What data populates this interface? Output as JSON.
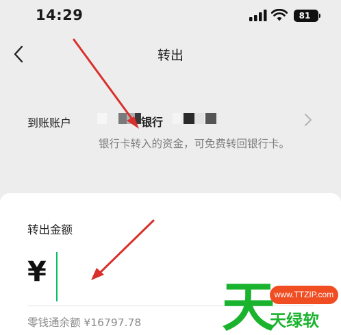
{
  "status_bar": {
    "time": "14:29",
    "battery_level": "81"
  },
  "nav": {
    "title": "转出",
    "back_icon": "chevron-left-icon"
  },
  "account": {
    "label": "到账账户",
    "bank_name": "银行",
    "note": "银行卡转入的资金，可免费转回银行卡。",
    "chevron_icon": "chevron-right-icon"
  },
  "amount": {
    "title": "转出金额",
    "currency_symbol": "¥",
    "value": "",
    "balance_text": "零钱通余额 ¥16797.78"
  },
  "watermark": {
    "big_char": "天",
    "site": "www.TTZIP.com",
    "text": "天绿软"
  },
  "colors": {
    "accent": "#07c160",
    "arrow": "#d9302c",
    "watermark_green": "#1ab32e",
    "watermark_red": "#f04d23"
  }
}
